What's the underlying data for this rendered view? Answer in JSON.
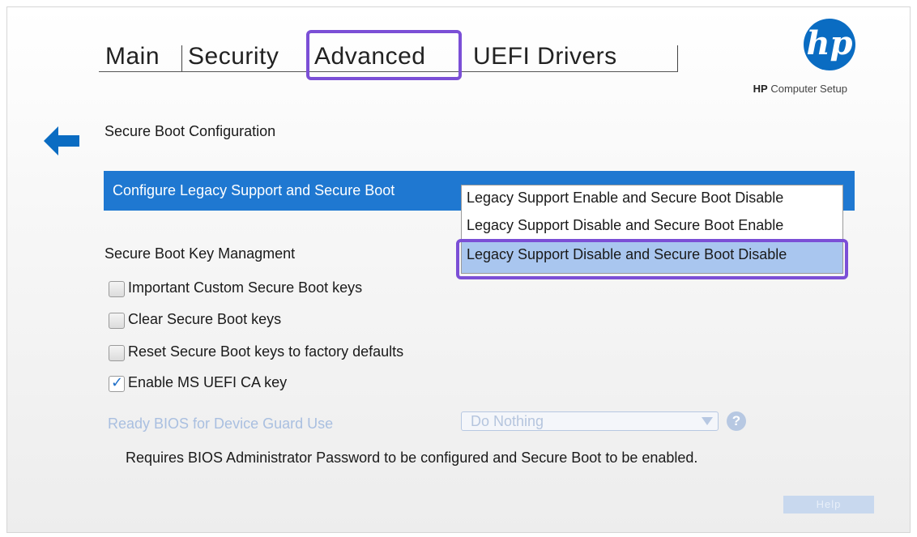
{
  "tabs": [
    {
      "label": "Main"
    },
    {
      "label": "Security"
    },
    {
      "label": "Advanced",
      "active": true
    },
    {
      "label": "UEFI Drivers"
    }
  ],
  "branding": {
    "logo_text": "hp",
    "subtitle_brand": "HP",
    "subtitle_rest": "Computer Setup"
  },
  "icons": {
    "back": "back-arrow-icon",
    "help": "question-circle-icon",
    "check": "checkmark-icon"
  },
  "sections": {
    "secure_boot_config": "Secure Boot Configuration",
    "key_management": "Secure Boot Key Managment"
  },
  "config_setting": {
    "label": "Configure Legacy Support and Secure Boot",
    "options": [
      "Legacy Support Enable and Secure Boot Disable",
      "Legacy Support Disable and Secure Boot Enable",
      "Legacy Support Disable and Secure Boot Disable"
    ],
    "selected_index": 2
  },
  "checkboxes": [
    {
      "label": "Important Custom Secure Boot keys",
      "checked": false
    },
    {
      "label": "Clear Secure Boot keys",
      "checked": false
    },
    {
      "label": "Reset Secure Boot keys to factory defaults",
      "checked": false
    },
    {
      "label": "Enable MS UEFI CA key",
      "checked": true
    }
  ],
  "device_guard": {
    "label": "Ready BIOS for Device Guard Use",
    "value": "Do Nothing",
    "help_glyph": "?"
  },
  "note": "Requires BIOS Administrator Password to be configured and Secure Boot to be enabled.",
  "help_button": "Help",
  "colors": {
    "accent": "#1f78d1",
    "selected_option": "#a9c6ef",
    "annotation_highlight": "#7b4fd6",
    "disabled_text": "#a9bfe0",
    "logo": "#0a6cc2"
  }
}
